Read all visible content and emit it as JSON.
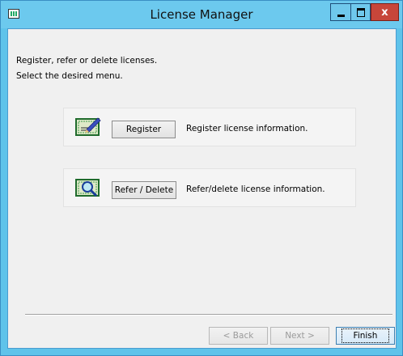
{
  "window": {
    "title": "License Manager",
    "icon": "app-icon",
    "controls": {
      "minimize": "minimize-icon",
      "maximize": "maximize-icon",
      "close_label": "x"
    }
  },
  "intro": {
    "line1": "Register, refer or delete licenses.",
    "line2": "Select the desired menu."
  },
  "options": [
    {
      "icon": "register-certificate-icon",
      "button": "Register",
      "description": "Register license information."
    },
    {
      "icon": "refer-delete-magnifier-icon",
      "button": "Refer / Delete",
      "description": "Refer/delete license information."
    }
  ],
  "footer": {
    "back": "< Back",
    "next": "Next >",
    "finish": "Finish"
  },
  "colors": {
    "titlebar": "#6cc9ee",
    "close_button": "#c7463a",
    "client_bg": "#f0f0f0"
  }
}
